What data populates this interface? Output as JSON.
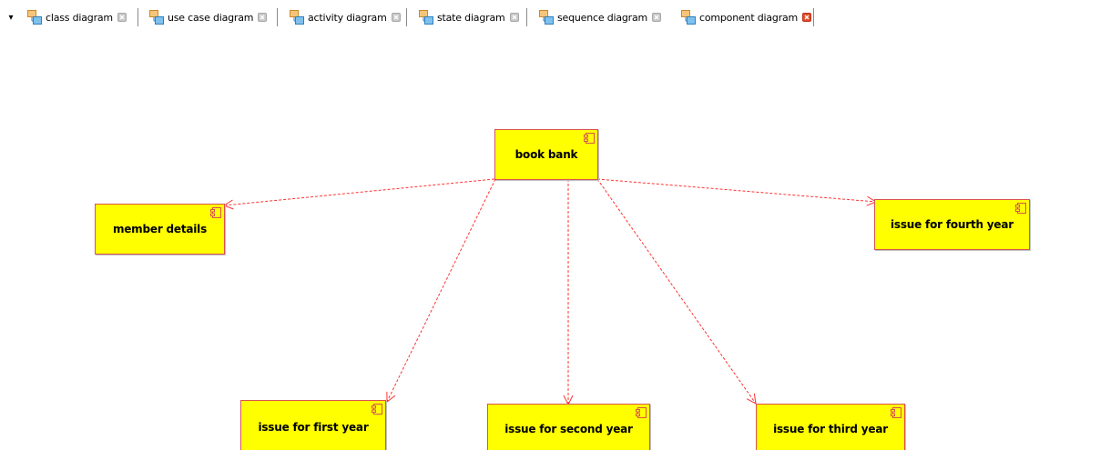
{
  "tabs": [
    {
      "label": "class diagram",
      "icon": "class-diagram-icon",
      "active": false
    },
    {
      "label": "use case diagram",
      "icon": "use-case-diagram-icon",
      "active": false
    },
    {
      "label": "activity diagram",
      "icon": "activity-diagram-icon",
      "active": false
    },
    {
      "label": "state diagram",
      "icon": "state-diagram-icon",
      "active": false
    },
    {
      "label": "sequence diagram",
      "icon": "sequence-diagram-icon",
      "active": false
    },
    {
      "label": "component diagram",
      "icon": "component-diagram-icon",
      "active": true
    }
  ],
  "diagram": {
    "components": [
      {
        "name": "book bank"
      },
      {
        "name": "member details"
      },
      {
        "name": "issue for fourth year"
      },
      {
        "name": "issue for first year"
      },
      {
        "name": "issue for second year"
      },
      {
        "name": "issue for third year"
      }
    ],
    "dependencies": [
      {
        "from": "book bank",
        "to": "member details"
      },
      {
        "from": "book bank",
        "to": "issue for fourth year"
      },
      {
        "from": "book bank",
        "to": "issue for first year"
      },
      {
        "from": "book bank",
        "to": "issue for second year"
      },
      {
        "from": "book bank",
        "to": "issue for third year"
      }
    ]
  },
  "colors": {
    "component_fill": "#ffff00",
    "component_border": "#d9534f",
    "dependency_line": "#ff3333",
    "close_active": "#e04a2a",
    "close_inactive": "#b8b8b8"
  }
}
